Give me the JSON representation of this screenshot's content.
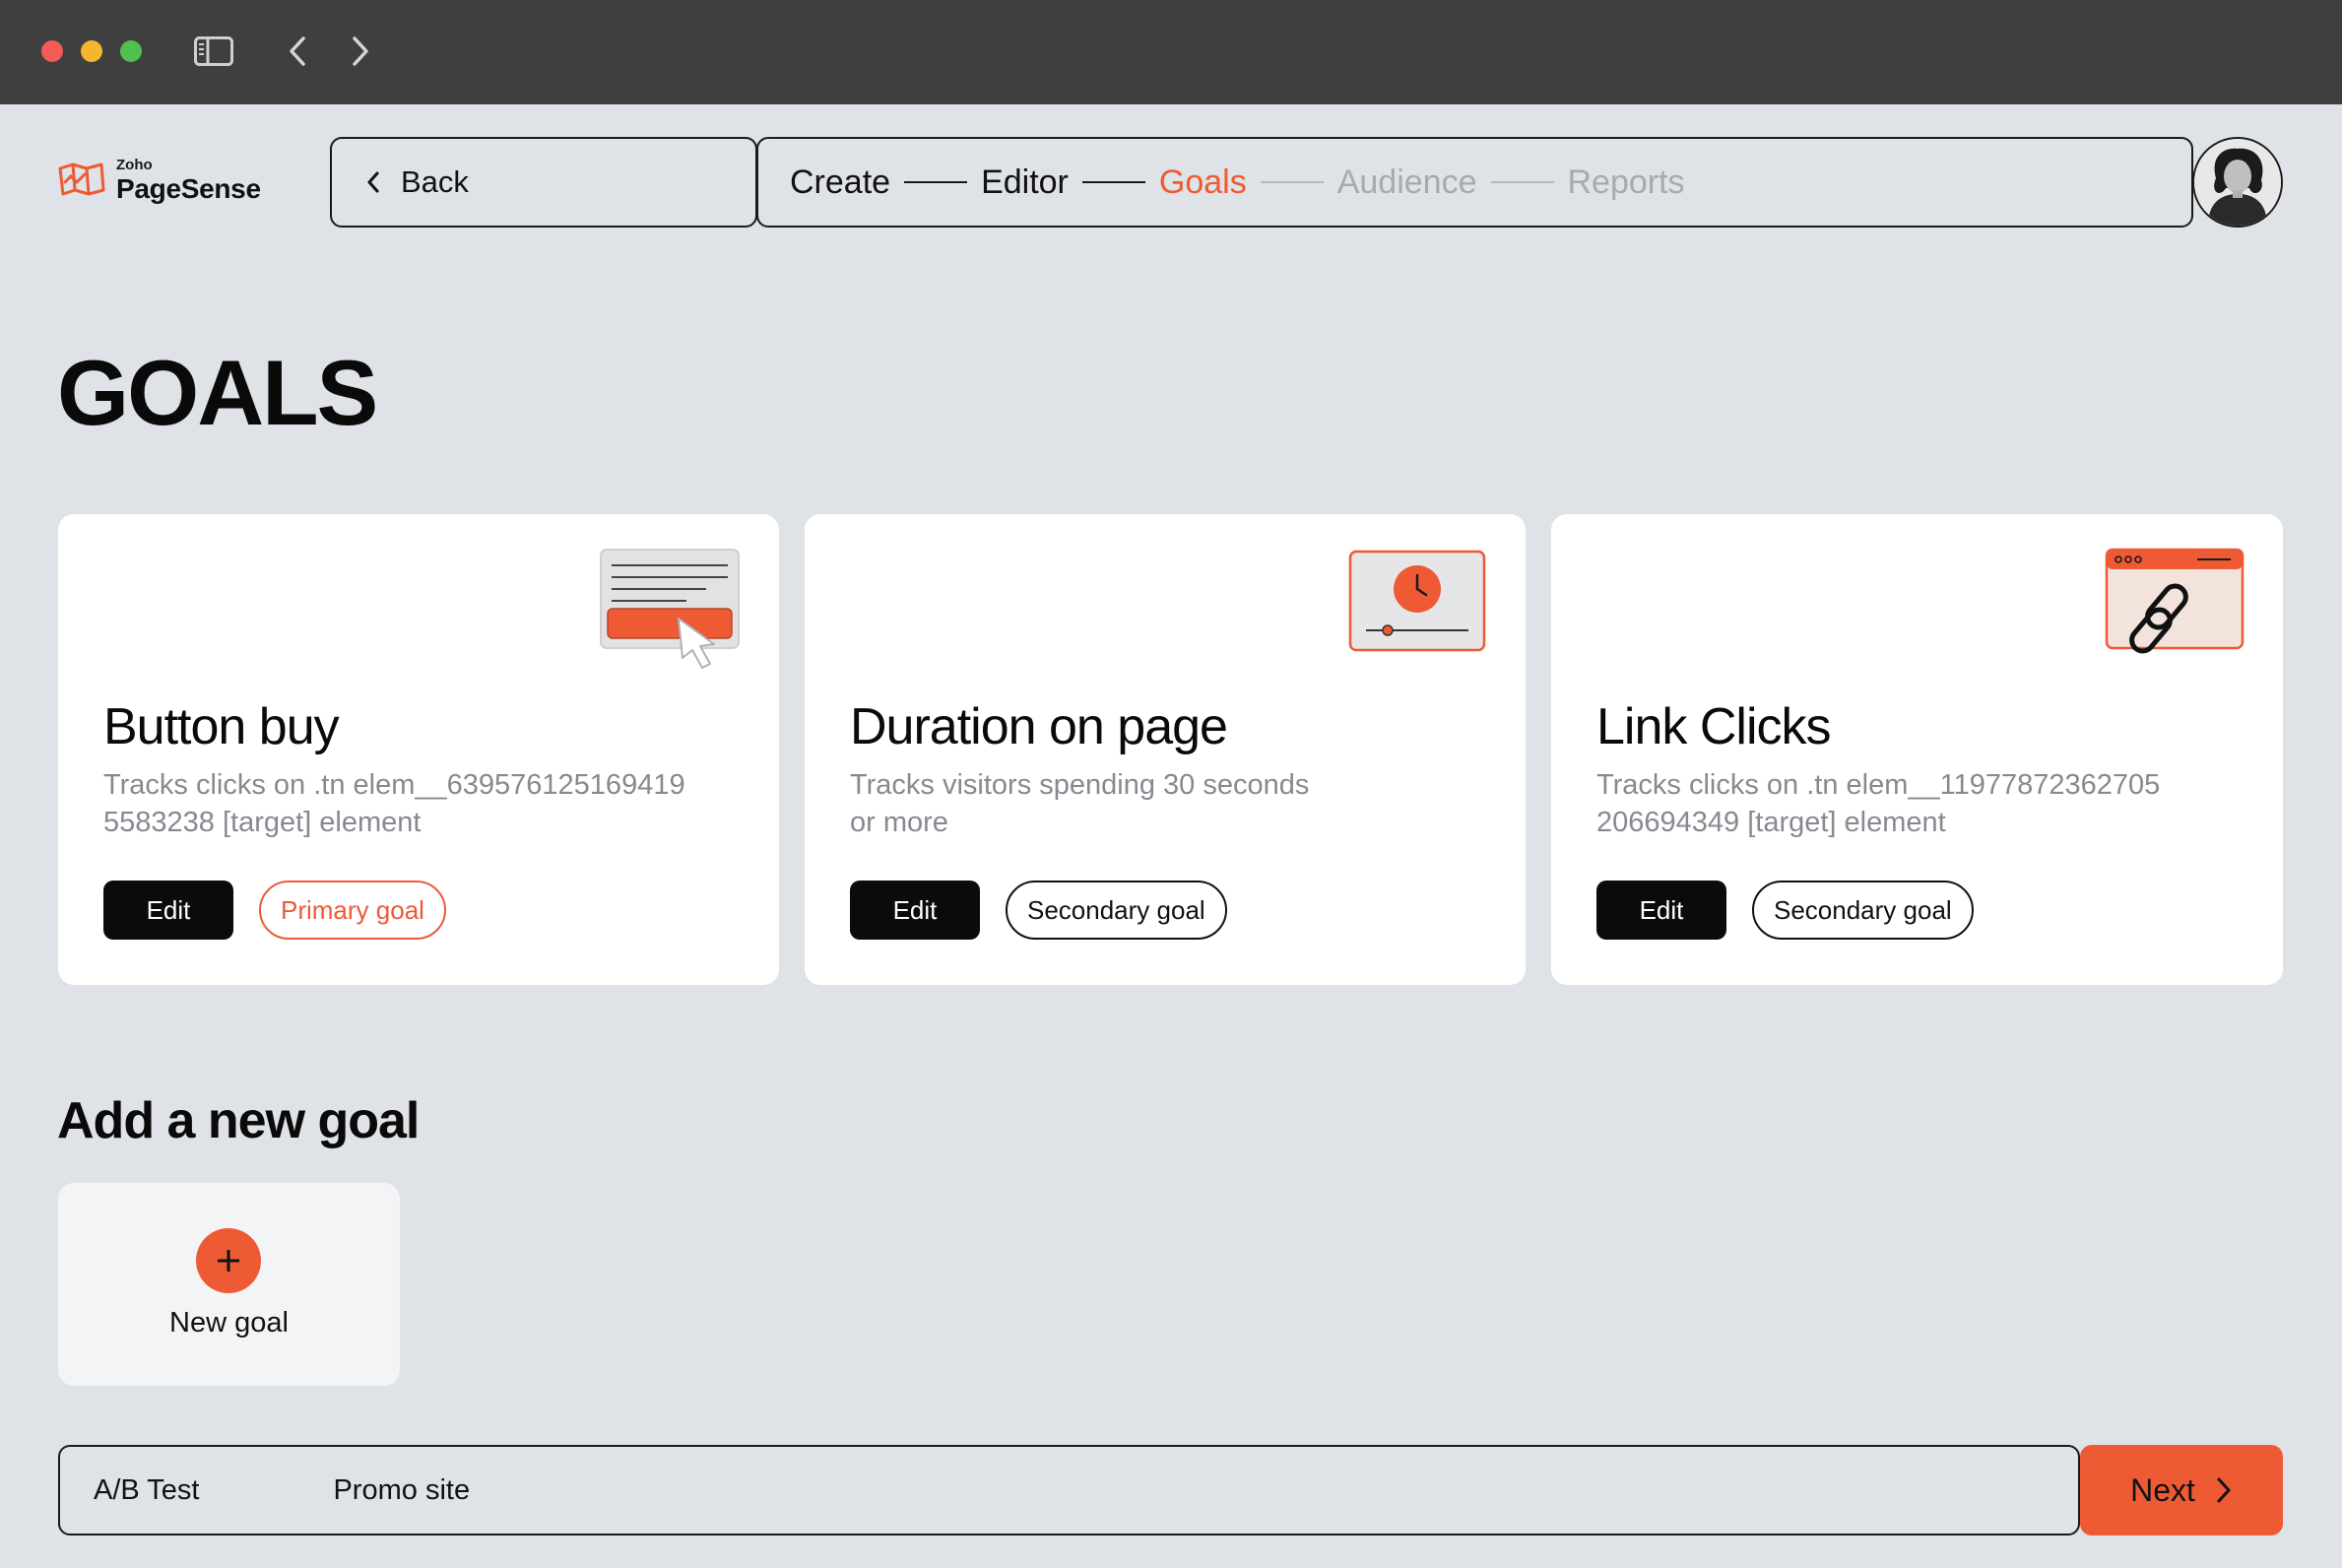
{
  "window": {
    "sidebar_icon": "sidebar-toggle-icon",
    "back_icon": "chevron-left-icon",
    "forward_icon": "chevron-right-icon"
  },
  "logo": {
    "small": "Zoho",
    "name": "PageSense"
  },
  "nav": {
    "back_label": "Back",
    "steps": [
      {
        "label": "Create",
        "state": "done"
      },
      {
        "label": "Editor",
        "state": "done"
      },
      {
        "label": "Goals",
        "state": "active"
      },
      {
        "label": "Audience",
        "state": "future"
      },
      {
        "label": "Reports",
        "state": "future"
      }
    ]
  },
  "page": {
    "title": "GOALS"
  },
  "goals": [
    {
      "title": "Button buy",
      "description": "Tracks clicks on .tn elem__639576125169419 5583238 [target] element",
      "edit_label": "Edit",
      "tag": "Primary goal",
      "icon": "button-click-icon"
    },
    {
      "title": "Duration on page",
      "description": "Tracks visitors spending 30 seconds or more",
      "edit_label": "Edit",
      "tag": "Secondary goal",
      "icon": "clock-timer-icon"
    },
    {
      "title": "Link Clicks",
      "description": "Tracks clicks on .tn elem__11977872362705 206694349 [target] element",
      "edit_label": "Edit",
      "tag": "Secondary goal",
      "icon": "link-icon"
    }
  ],
  "add_section": {
    "title": "Add a new goal",
    "new_goal_label": "New goal"
  },
  "footer": {
    "test_type": "A/B Test",
    "site": "Promo site",
    "next_label": "Next"
  },
  "colors": {
    "accent": "#ee5a34",
    "background": "#dfe2e6",
    "titlebar": "#3f3f3f"
  }
}
